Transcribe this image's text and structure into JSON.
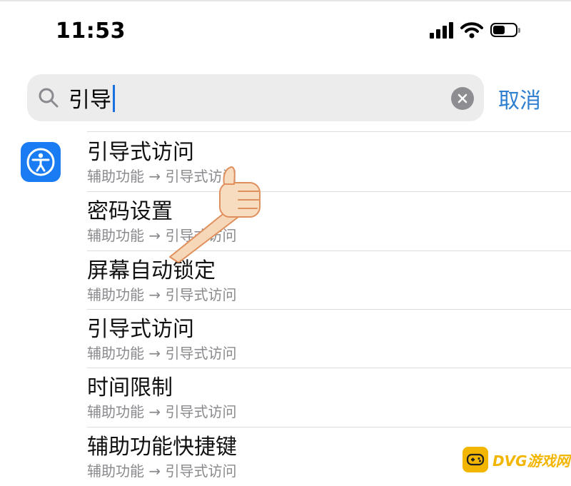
{
  "status_bar": {
    "time": "11:53"
  },
  "search": {
    "query": "引导",
    "cancel_label": "取消"
  },
  "results": [
    {
      "title": "引导式访问",
      "subtitle": "辅助功能 → 引导式访问"
    },
    {
      "title": "密码设置",
      "subtitle": "辅助功能 → 引导式访问"
    },
    {
      "title": "屏幕自动锁定",
      "subtitle": "辅助功能 → 引导式访问"
    },
    {
      "title": "引导式访问",
      "subtitle": "辅助功能 → 引导式访问"
    },
    {
      "title": "时间限制",
      "subtitle": "辅助功能 → 引导式访问"
    },
    {
      "title": "辅助功能快捷键",
      "subtitle": "辅助功能 → 引导式访问"
    }
  ],
  "watermark": {
    "text": "DVG游戏网"
  },
  "colors": {
    "accent": "#2f7fd1",
    "app_icon": "#1a7cf2",
    "watermark": "#f3b600"
  }
}
